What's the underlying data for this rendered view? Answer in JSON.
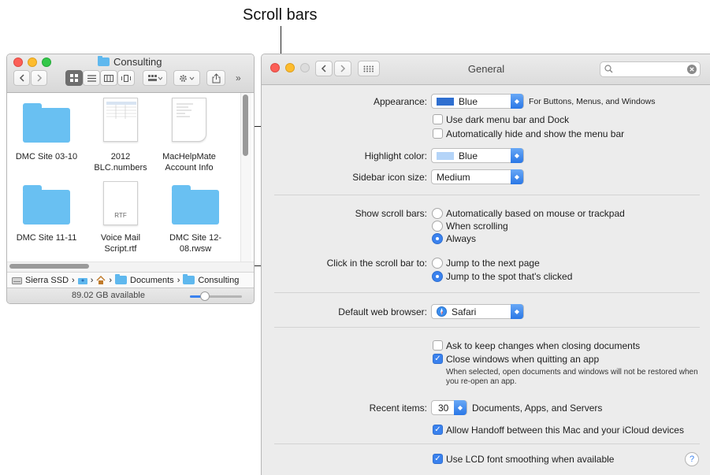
{
  "callout": {
    "text": "Scroll bars"
  },
  "finder": {
    "title": "Consulting",
    "items": [
      {
        "name": "DMC Site 03-10"
      },
      {
        "name": "2012 BLC.numbers"
      },
      {
        "name": "MacHelpMate Account Info"
      },
      {
        "name": "DMC Site 11-11"
      },
      {
        "name": "Voice Mail Script.rtf",
        "badge": "RTF"
      },
      {
        "name": "DMC Site 12-08.rwsw"
      }
    ],
    "path": [
      "Sierra SSD",
      "Documents",
      "Consulting"
    ],
    "path_separator": "›",
    "status": "89.02 GB available"
  },
  "prefs": {
    "title": "General",
    "search_placeholder": "",
    "appearance": {
      "label": "Appearance:",
      "value": "Blue",
      "note": "For Buttons, Menus, and Windows"
    },
    "dark_menu": "Use dark menu bar and Dock",
    "auto_hide": "Automatically hide and show the menu bar",
    "highlight": {
      "label": "Highlight color:",
      "value": "Blue"
    },
    "sidebar_size": {
      "label": "Sidebar icon size:",
      "value": "Medium"
    },
    "show_scroll": {
      "label": "Show scroll bars:",
      "options": [
        "Automatically based on mouse or trackpad",
        "When scrolling",
        "Always"
      ],
      "selected": "Always"
    },
    "click_scroll": {
      "label": "Click in the scroll bar to:",
      "options": [
        "Jump to the next page",
        "Jump to the spot that's clicked"
      ],
      "selected": "Jump to the spot that's clicked"
    },
    "browser": {
      "label": "Default web browser:",
      "value": "Safari"
    },
    "ask_keep": "Ask to keep changes when closing documents",
    "close_windows": "Close windows when quitting an app",
    "close_note": "When selected, open documents and windows will not be restored when you re-open an app.",
    "recent": {
      "label": "Recent items:",
      "value": "30",
      "suffix": "Documents, Apps, and Servers"
    },
    "handoff": "Allow Handoff between this Mac and your iCloud devices",
    "lcd": "Use LCD font smoothing when available",
    "help_symbol": "?",
    "checkmark": "✓",
    "colors": {
      "accent": "#3b82ee",
      "folder": "#69c0f2"
    }
  }
}
